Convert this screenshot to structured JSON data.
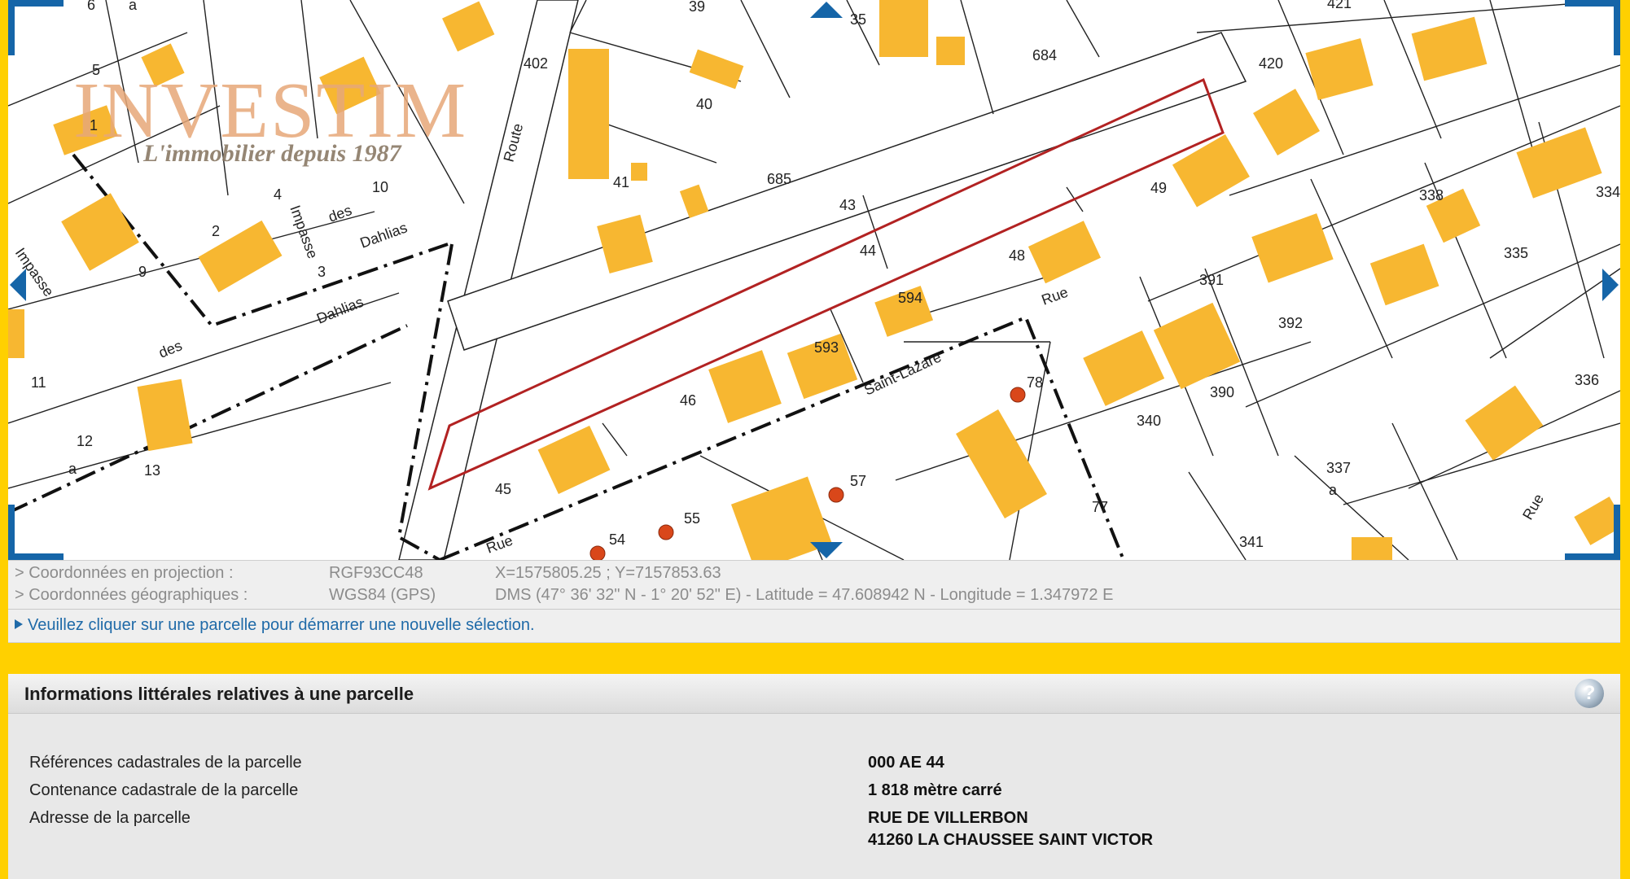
{
  "logo": {
    "name": "INVESTIM",
    "tagline": "L'immobilier depuis 1987"
  },
  "map": {
    "parcels": [
      "6",
      "a",
      "5",
      "1",
      "39",
      "35",
      "421",
      "402",
      "684",
      "420",
      "40",
      "41",
      "685",
      "43",
      "10",
      "4",
      "2",
      "9",
      "3",
      "44",
      "49",
      "334",
      "48",
      "594",
      "391",
      "338",
      "335",
      "392",
      "593",
      "46",
      "78",
      "340",
      "390",
      "336",
      "11",
      "12",
      "a",
      "13",
      "45",
      "57",
      "55",
      "54",
      "77",
      "337",
      "a",
      "341"
    ],
    "streets": [
      "Route",
      "Impasse",
      "des",
      "Dahlias",
      "Impasse",
      "des",
      "Dahlias",
      "Rue",
      "Saint-Lazare",
      "Rue",
      "Rue"
    ],
    "colors": {
      "building": "#f7b731",
      "parcel_line": "#222222",
      "selected_parcel": "#b22222",
      "map_bg": "#ffffff",
      "frame": "#ffd000",
      "nav": "#1565a8"
    },
    "nav": {
      "up": "chevron-up-icon",
      "down": "chevron-down-icon",
      "left": "chevron-left-icon",
      "right": "chevron-right-icon"
    }
  },
  "coords": {
    "projection": {
      "label": "> Coordonnées en projection :",
      "system": "RGF93CC48",
      "value": "X=1575805.25 ; Y=7157853.63"
    },
    "geographic": {
      "label": "> Coordonnées géographiques :",
      "system": "WGS84 (GPS)",
      "value": "DMS (47° 36' 32\" N - 1° 20' 52\" E) - Latitude = 47.608942 N - Longitude = 1.347972 E"
    },
    "hint": "Veuillez cliquer sur une parcelle pour démarrer une nouvelle sélection."
  },
  "panel": {
    "title": "Informations littérales relatives à une parcelle",
    "help_icon": "help-icon",
    "help_label": "?",
    "rows": [
      {
        "label": "Références cadastrales de la parcelle",
        "value": "000 AE 44"
      },
      {
        "label": "Contenance cadastrale de la parcelle",
        "value": "1 818 mètre carré"
      },
      {
        "label": "Adresse de la parcelle",
        "value": "RUE DE VILLERBON",
        "value2": "41260 LA CHAUSSEE SAINT VICTOR"
      }
    ]
  }
}
